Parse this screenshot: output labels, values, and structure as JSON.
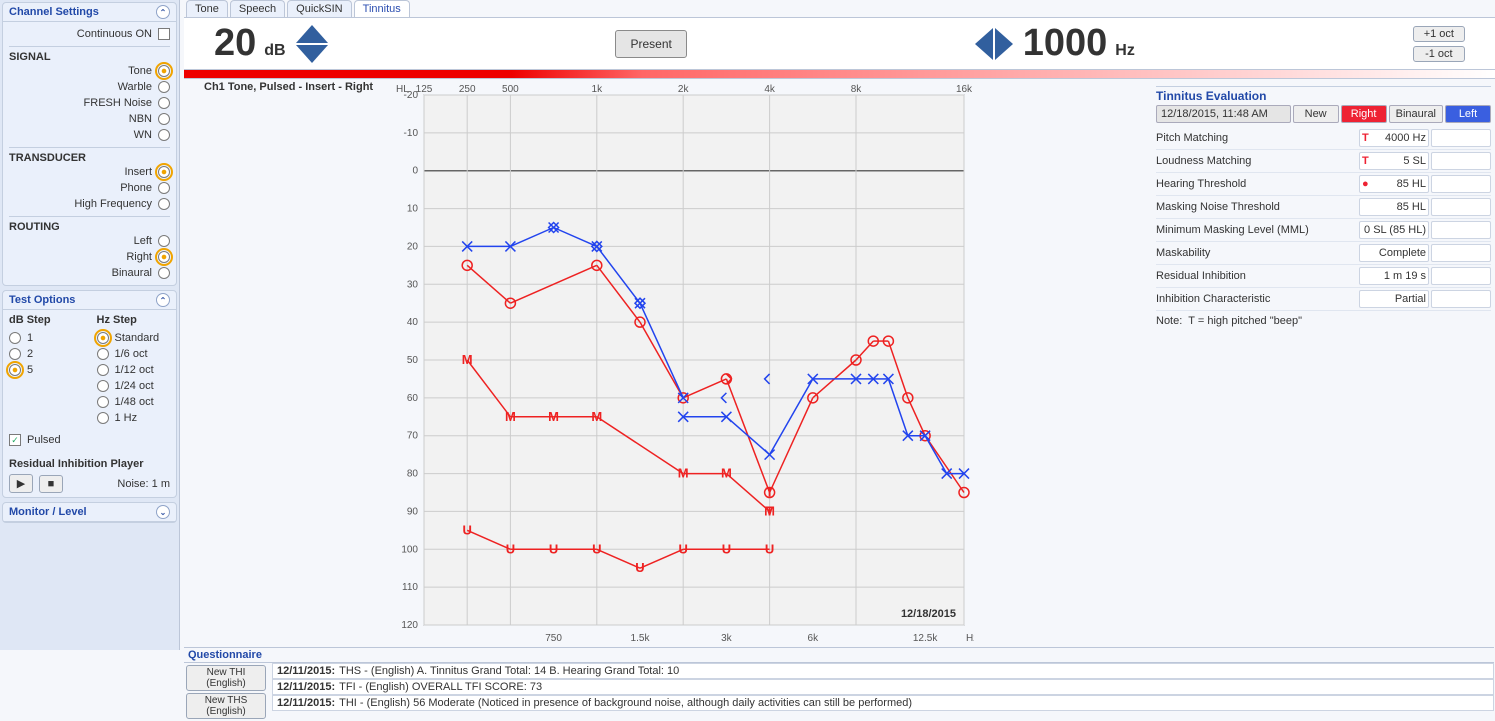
{
  "tabs": [
    "Tone",
    "Speech",
    "QuickSIN",
    "Tinnitus"
  ],
  "active_tab": "Tinnitus",
  "stimulus": {
    "db_value": "20",
    "db_unit": "dB",
    "hz_value": "1000",
    "hz_unit": "Hz",
    "present_label": "Present",
    "oct_up": "+1 oct",
    "oct_down": "-1 oct"
  },
  "channel_info": "Ch1  Tone, Pulsed - Insert - Right",
  "channel_settings": {
    "title": "Channel Settings",
    "continuous": "Continuous ON",
    "signal_label": "SIGNAL",
    "signals": [
      "Tone",
      "Warble",
      "FRESH Noise",
      "NBN",
      "WN"
    ],
    "signal_selected": "Tone",
    "transducer_label": "TRANSDUCER",
    "transducers": [
      "Insert",
      "Phone",
      "High Frequency"
    ],
    "transducer_selected": "Insert",
    "routing_label": "ROUTING",
    "routings": [
      "Left",
      "Right",
      "Binaural"
    ],
    "routing_selected": "Right"
  },
  "test_options": {
    "title": "Test Options",
    "db_step_title": "dB Step",
    "db_steps": [
      "1",
      "2",
      "5"
    ],
    "db_step_selected": "5",
    "hz_step_title": "Hz Step",
    "hz_steps": [
      "Standard",
      "1/6 oct",
      "1/12 oct",
      "1/24 oct",
      "1/48 oct",
      "1 Hz"
    ],
    "hz_step_selected": "Standard",
    "pulsed_label": "Pulsed",
    "residual_title": "Residual Inhibition Player",
    "noise_label": "Noise: 1 m"
  },
  "monitor_title": "Monitor / Level",
  "tinnitus_eval": {
    "title": "Tinnitus Evaluation",
    "datetime": "12/18/2015, 11:48 AM",
    "new_label": "New",
    "right_label": "Right",
    "binaural_label": "Binaural",
    "left_label": "Left",
    "rows": [
      {
        "label": "Pitch Matching",
        "marker": "T",
        "value": "4000 Hz"
      },
      {
        "label": "Loudness Matching",
        "marker": "T",
        "value": "5 SL"
      },
      {
        "label": "Hearing Threshold",
        "marker": "dot",
        "value": "85 HL"
      },
      {
        "label": "Masking Noise Threshold",
        "marker": "",
        "value": "85 HL"
      },
      {
        "label": "Minimum Masking Level (MML)",
        "marker": "",
        "value": "0 SL (85 HL)"
      },
      {
        "label": "Maskability",
        "marker": "",
        "value": "Complete"
      },
      {
        "label": "Residual Inhibition",
        "marker": "",
        "value": "1 m 19 s"
      },
      {
        "label": "Inhibition Characteristic",
        "marker": "",
        "value": "Partial"
      }
    ],
    "note_label": "Note:",
    "note_text": "T = high pitched \"beep\""
  },
  "questionnaire": {
    "title": "Questionnaire",
    "btn1": "New THI\n(English)",
    "btn2": "New THS\n(English)",
    "rows": [
      {
        "date": "12/11/2015:",
        "text": "THS - (English) A. Tinnitus Grand Total: 14 B. Hearing Grand Total: 10"
      },
      {
        "date": "12/11/2015:",
        "text": "TFI - (English) OVERALL TFI SCORE: 73"
      },
      {
        "date": "12/11/2015:",
        "text": "THI - (English) 56 Moderate (Noticed in presence of background noise, although daily activities can still be performed)"
      }
    ]
  },
  "chart_data": {
    "type": "audiogram",
    "x_top_labels": [
      "125",
      "250",
      "500",
      "1k",
      "2k",
      "4k",
      "8k",
      "16k"
    ],
    "x_bottom_labels": [
      "750",
      "1.5k",
      "3k",
      "6k",
      "12.5k"
    ],
    "y_label_top": "HL",
    "x_label_bottom": "Hz",
    "y_range": [
      -20,
      120
    ],
    "date_label": "12/18/2015",
    "freq_index": {
      "125": 0,
      "250": 1,
      "500": 2,
      "750": 3,
      "1000": 4,
      "1500": 5,
      "2000": 6,
      "3000": 7,
      "4000": 8,
      "6000": 9,
      "8000": 10,
      "9000": 10.4,
      "10000": 10.75,
      "11200": 11.2,
      "12500": 11.6,
      "14000": 12.1,
      "16000": 12.5
    },
    "series": [
      {
        "name": "right_air",
        "symbol": "O",
        "color": "#e22",
        "connect": true,
        "points": [
          {
            "f": 250,
            "hl": 25
          },
          {
            "f": 500,
            "hl": 35
          },
          {
            "f": 1000,
            "hl": 25
          },
          {
            "f": 1500,
            "hl": 40
          },
          {
            "f": 2000,
            "hl": 60
          },
          {
            "f": 3000,
            "hl": 55
          },
          {
            "f": 4000,
            "hl": 85
          },
          {
            "f": 6000,
            "hl": 60
          },
          {
            "f": 8000,
            "hl": 50
          },
          {
            "f": 9000,
            "hl": 45
          },
          {
            "f": 10000,
            "hl": 45
          },
          {
            "f": 11200,
            "hl": 60
          },
          {
            "f": 12500,
            "hl": 70
          },
          {
            "f": 16000,
            "hl": 85
          }
        ]
      },
      {
        "name": "left_air",
        "symbol": "X",
        "color": "#24e",
        "connect": true,
        "points": [
          {
            "f": 250,
            "hl": 20
          },
          {
            "f": 500,
            "hl": 20
          },
          {
            "f": 750,
            "hl": 15
          },
          {
            "f": 1000,
            "hl": 20
          },
          {
            "f": 1500,
            "hl": 35
          },
          {
            "f": 2000,
            "hl": 60
          },
          {
            "f": 2000,
            "hl": 65,
            "skip_connect": true
          },
          {
            "f": 3000,
            "hl": 65
          },
          {
            "f": 4000,
            "hl": 75
          },
          {
            "f": 6000,
            "hl": 55
          },
          {
            "f": 8000,
            "hl": 55
          },
          {
            "f": 9000,
            "hl": 55
          },
          {
            "f": 10000,
            "hl": 55
          },
          {
            "f": 11200,
            "hl": 70
          },
          {
            "f": 12500,
            "hl": 70
          },
          {
            "f": 14000,
            "hl": 80
          },
          {
            "f": 16000,
            "hl": 80
          }
        ]
      },
      {
        "name": "right_bone_half_sym",
        "symbol": "half-diamond-right",
        "color": "#e22",
        "connect": false,
        "points": [
          {
            "f": 3000,
            "hl": 55
          }
        ]
      },
      {
        "name": "left_bone_half_sym",
        "symbol": "half-diamond-left",
        "color": "#24e",
        "connect": false,
        "points": [
          {
            "f": 3000,
            "hl": 60
          },
          {
            "f": 4000,
            "hl": 55
          }
        ]
      },
      {
        "name": "right_bone",
        "symbol": "diamond",
        "color": "#24e",
        "connect": false,
        "points": [
          {
            "f": 750,
            "hl": 15
          },
          {
            "f": 1000,
            "hl": 20
          },
          {
            "f": 1500,
            "hl": 35
          }
        ]
      },
      {
        "name": "tinnitus_T",
        "symbol": "T",
        "color": "#e22",
        "connect": false,
        "points": [
          {
            "f": 4000,
            "hl": 90
          },
          {
            "f": 4000,
            "hl": 85,
            "filled": true
          }
        ]
      },
      {
        "name": "mcl_M",
        "symbol": "M",
        "color": "#e22",
        "connect": true,
        "points": [
          {
            "f": 250,
            "hl": 50
          },
          {
            "f": 500,
            "hl": 65
          },
          {
            "f": 750,
            "hl": 65
          },
          {
            "f": 1000,
            "hl": 65
          },
          {
            "f": 2000,
            "hl": 80
          },
          {
            "f": 3000,
            "hl": 80
          },
          {
            "f": 4000,
            "hl": 90
          }
        ]
      },
      {
        "name": "ucl_U",
        "symbol": "U",
        "color": "#e22",
        "connect": true,
        "points": [
          {
            "f": 250,
            "hl": 95
          },
          {
            "f": 500,
            "hl": 100
          },
          {
            "f": 750,
            "hl": 100
          },
          {
            "f": 1000,
            "hl": 100
          },
          {
            "f": 1500,
            "hl": 105
          },
          {
            "f": 2000,
            "hl": 100
          },
          {
            "f": 3000,
            "hl": 100
          },
          {
            "f": 4000,
            "hl": 100
          }
        ]
      }
    ]
  }
}
